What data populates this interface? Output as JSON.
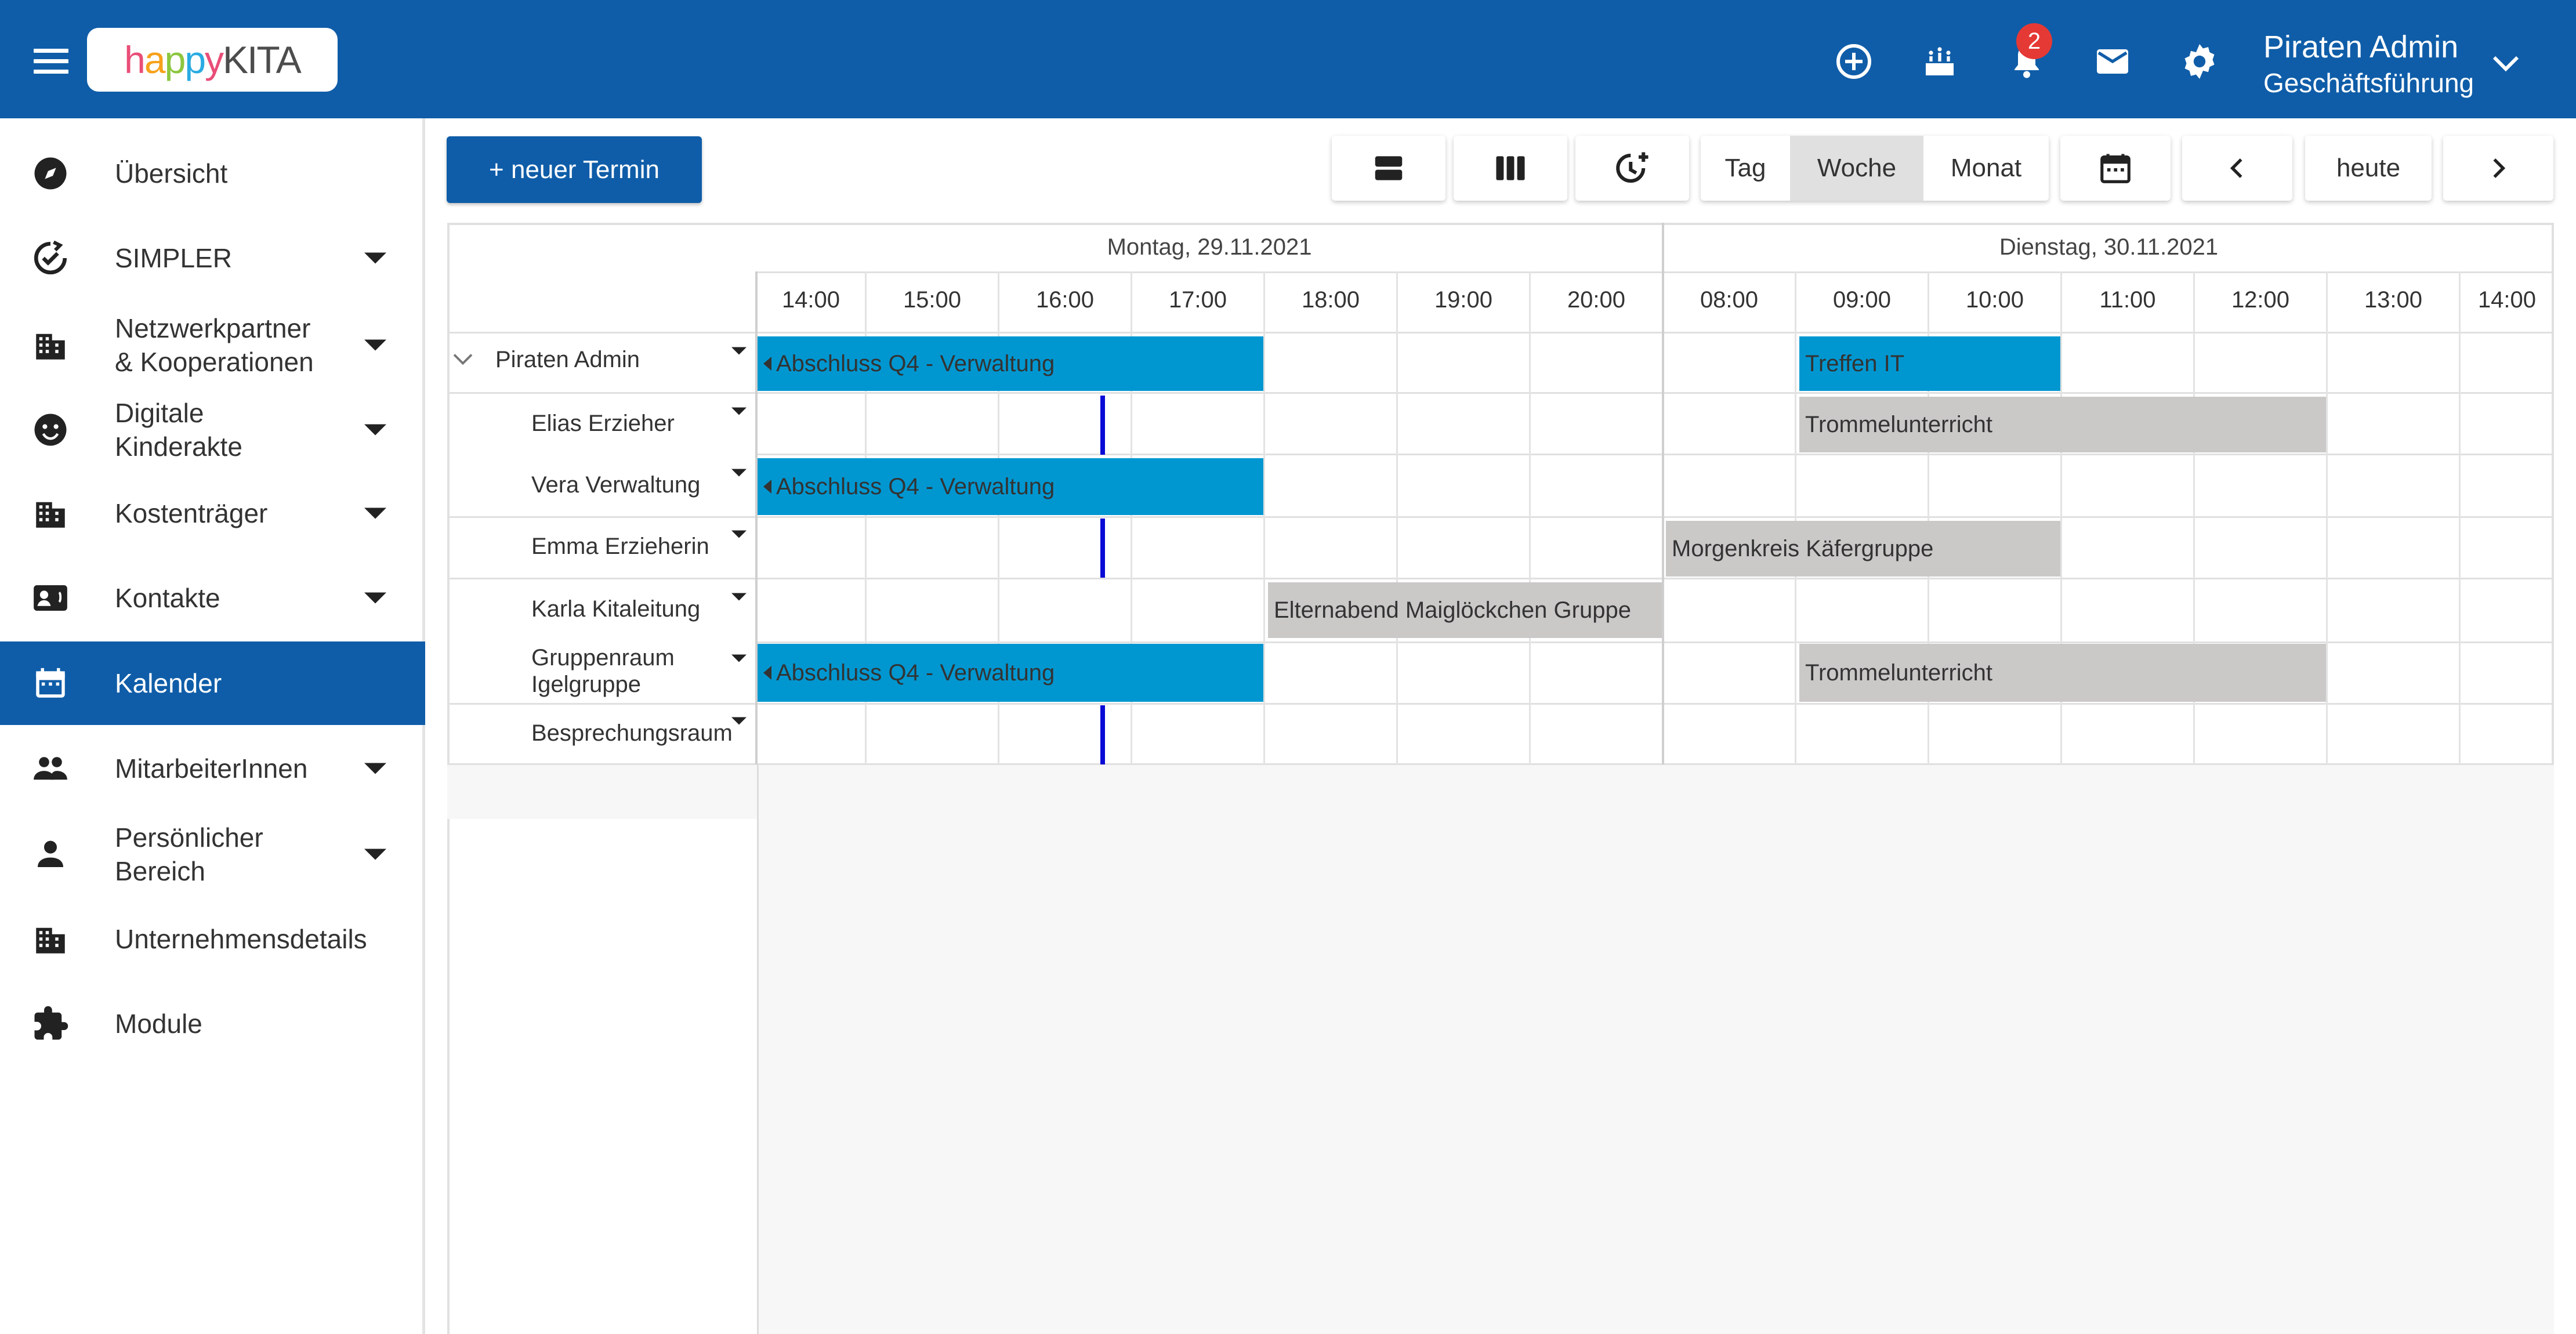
{
  "header": {
    "logo_parts": [
      "h",
      "a",
      "p",
      "p",
      "y",
      "KITA"
    ],
    "notification_count": "2",
    "user_name": "Piraten Admin",
    "user_role": "Geschäftsführung",
    "icons": [
      "menu-icon",
      "add-circle-icon",
      "birthday-cake-icon",
      "bell-icon",
      "mail-icon",
      "gear-icon",
      "chevron-down-icon"
    ]
  },
  "sidebar": {
    "items": [
      {
        "label": "Übersicht",
        "icon": "compass-icon",
        "has_submenu": false
      },
      {
        "label": "SIMPLER",
        "icon": "sync-check-icon",
        "has_submenu": true
      },
      {
        "label": "Netzwerkpartner\n& Kooperationen",
        "label_line1": "Netzwerkpartner",
        "label_line2": "& Kooperationen",
        "icon": "building-icon",
        "has_submenu": true
      },
      {
        "label_line1": "Digitale",
        "label_line2": "Kinderakte",
        "icon": "smiley-icon",
        "has_submenu": true
      },
      {
        "label": "Kostenträger",
        "icon": "building-icon",
        "has_submenu": true
      },
      {
        "label": "Kontakte",
        "icon": "contact-card-icon",
        "has_submenu": true
      },
      {
        "label": "Kalender",
        "icon": "calendar-icon",
        "has_submenu": false,
        "active": true
      },
      {
        "label": "MitarbeiterInnen",
        "icon": "people-icon",
        "has_submenu": true
      },
      {
        "label_line1": "Persönlicher",
        "label_line2": "Bereich",
        "icon": "person-icon",
        "has_submenu": true
      },
      {
        "label": "Unternehmensdetails",
        "icon": "building-icon",
        "has_submenu": false
      },
      {
        "label": "Module",
        "icon": "puzzle-icon",
        "has_submenu": false
      }
    ]
  },
  "toolbar": {
    "new_event_label": "+ neuer Termin",
    "view_tag": "Tag",
    "view_woche": "Woche",
    "view_monat": "Monat",
    "selected_view": "Woche",
    "today_label": "heute",
    "icons": [
      "rows-view-icon",
      "columns-view-icon",
      "clock-add-icon",
      "calendar-picker-icon",
      "chevron-left-icon",
      "chevron-right-icon"
    ]
  },
  "calendar": {
    "days": [
      {
        "label": "Montag, 29.11.2021",
        "slots": [
          "14:00",
          "15:00",
          "16:00",
          "17:00",
          "18:00",
          "19:00",
          "20:00"
        ]
      },
      {
        "label": "Dienstag, 30.11.2021",
        "slots": [
          "08:00",
          "09:00",
          "10:00",
          "11:00",
          "12:00",
          "13:00",
          "14:00"
        ]
      }
    ],
    "resources": [
      {
        "label": "Piraten Admin",
        "level": 0
      },
      {
        "label": "Elias Erzieher",
        "level": 1
      },
      {
        "label": "Vera Verwaltung",
        "level": 1
      },
      {
        "label": "Emma Erzieherin",
        "level": 1
      },
      {
        "label": "Karla Kitaleitung",
        "level": 1
      },
      {
        "label_line1": "Gruppenraum",
        "label_line2": "Igelgruppe",
        "level": 1
      },
      {
        "label": "Besprechungsraum",
        "level": 1
      }
    ],
    "events": [
      {
        "title": "Abschluss Q4 - Verwaltung",
        "resource": "Piraten Admin",
        "day": "Montag, 29.11.2021",
        "start": "14:00",
        "end": "18:00",
        "color": "#0097d1",
        "continues_before": true
      },
      {
        "title": "Treffen IT",
        "resource": "Piraten Admin",
        "day": "Dienstag, 30.11.2021",
        "start": "09:00",
        "end": "11:00",
        "color": "#0097d1"
      },
      {
        "title": "Trommelunterricht",
        "resource": "Elias Erzieher",
        "day": "Dienstag, 30.11.2021",
        "start": "09:00",
        "end": "13:00",
        "color": "#cbc8c8"
      },
      {
        "title": "Abschluss Q4 - Verwaltung",
        "resource": "Vera Verwaltung",
        "day": "Montag, 29.11.2021",
        "start": "14:00",
        "end": "18:00",
        "color": "#0097d1",
        "continues_before": true
      },
      {
        "title": "Morgenkreis Käfergruppe",
        "resource": "Emma Erzieherin",
        "day": "Dienstag, 30.11.2021",
        "start": "08:00",
        "end": "11:00",
        "color": "#cbc8c8"
      },
      {
        "title": "Elternabend Maiglöckchen Gruppe",
        "resource": "Karla Kitaleitung",
        "day": "Montag, 29.11.2021",
        "start": "18:00",
        "end": "21:00",
        "color": "#cbc8c8"
      },
      {
        "title": "Abschluss Q4 - Verwaltung",
        "resource": "Gruppenraum Igelgruppe",
        "day": "Montag, 29.11.2021",
        "start": "14:00",
        "end": "18:00",
        "color": "#0097d1",
        "continues_before": true
      },
      {
        "title": "Trommelunterricht",
        "resource": "Gruppenraum Igelgruppe",
        "day": "Dienstag, 30.11.2021",
        "start": "09:00",
        "end": "13:00",
        "color": "#cbc8c8"
      }
    ]
  }
}
